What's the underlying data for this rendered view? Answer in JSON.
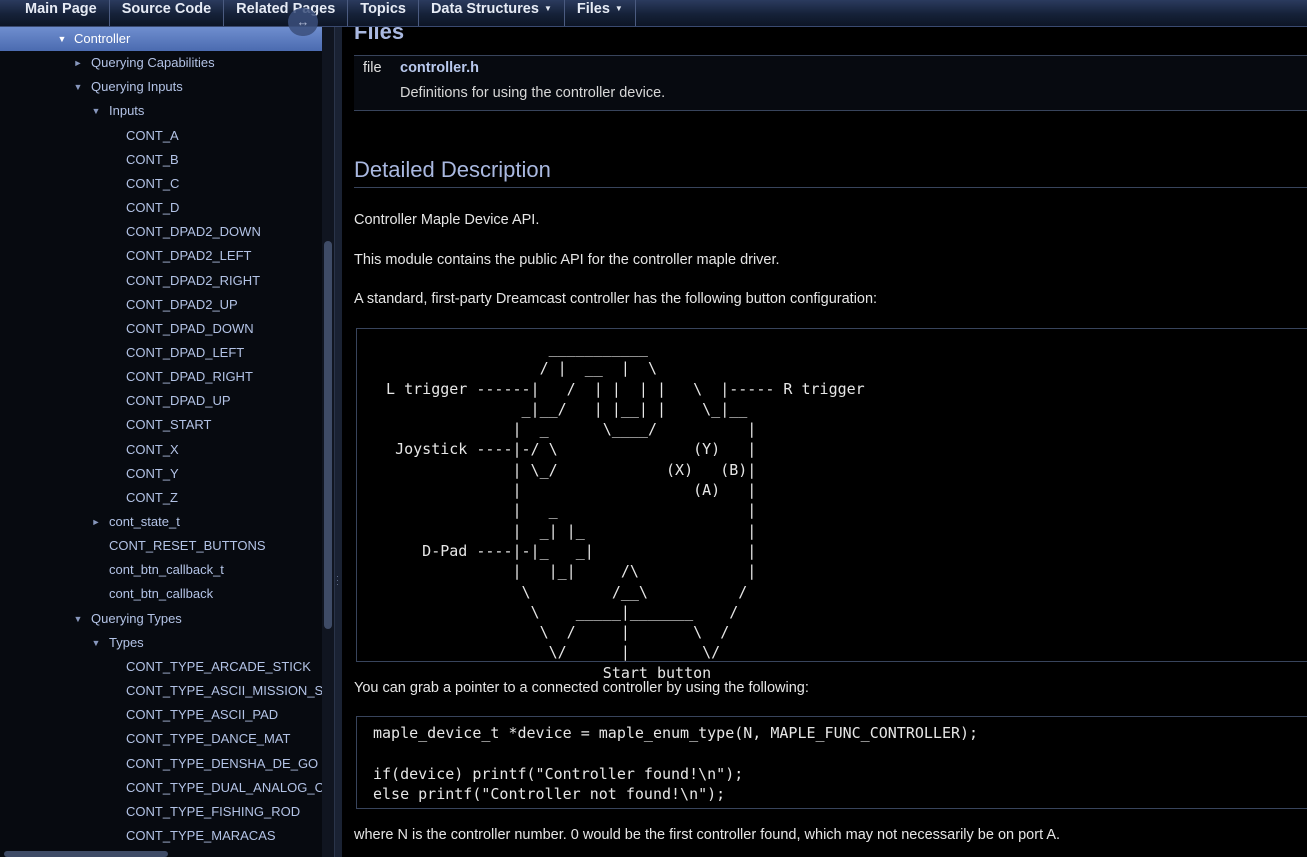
{
  "nav": {
    "items": [
      {
        "label": "Main Page",
        "dropdown": false
      },
      {
        "label": "Source Code",
        "dropdown": false
      },
      {
        "label": "Related Pages",
        "dropdown": false
      },
      {
        "label": "Topics",
        "dropdown": false
      },
      {
        "label": "Data Structures",
        "dropdown": true
      },
      {
        "label": "Files",
        "dropdown": true
      }
    ]
  },
  "sidebar": {
    "sync_icon": "sync-arrows-icon",
    "items": [
      {
        "label": "Controller",
        "level": 0,
        "arrow": "open",
        "selected": true
      },
      {
        "label": "Querying Capabilities",
        "level": 1,
        "arrow": "closed"
      },
      {
        "label": "Querying Inputs",
        "level": 1,
        "arrow": "open"
      },
      {
        "label": "Inputs",
        "level": 2,
        "arrow": "open"
      },
      {
        "label": "CONT_A",
        "level": 3,
        "arrow": "none"
      },
      {
        "label": "CONT_B",
        "level": 3,
        "arrow": "none"
      },
      {
        "label": "CONT_C",
        "level": 3,
        "arrow": "none"
      },
      {
        "label": "CONT_D",
        "level": 3,
        "arrow": "none"
      },
      {
        "label": "CONT_DPAD2_DOWN",
        "level": 3,
        "arrow": "none"
      },
      {
        "label": "CONT_DPAD2_LEFT",
        "level": 3,
        "arrow": "none"
      },
      {
        "label": "CONT_DPAD2_RIGHT",
        "level": 3,
        "arrow": "none"
      },
      {
        "label": "CONT_DPAD2_UP",
        "level": 3,
        "arrow": "none"
      },
      {
        "label": "CONT_DPAD_DOWN",
        "level": 3,
        "arrow": "none"
      },
      {
        "label": "CONT_DPAD_LEFT",
        "level": 3,
        "arrow": "none"
      },
      {
        "label": "CONT_DPAD_RIGHT",
        "level": 3,
        "arrow": "none"
      },
      {
        "label": "CONT_DPAD_UP",
        "level": 3,
        "arrow": "none"
      },
      {
        "label": "CONT_START",
        "level": 3,
        "arrow": "none"
      },
      {
        "label": "CONT_X",
        "level": 3,
        "arrow": "none"
      },
      {
        "label": "CONT_Y",
        "level": 3,
        "arrow": "none"
      },
      {
        "label": "CONT_Z",
        "level": 3,
        "arrow": "none"
      },
      {
        "label": "cont_state_t",
        "level": 2,
        "arrow": "closed"
      },
      {
        "label": "CONT_RESET_BUTTONS",
        "level": 2,
        "arrow": "none"
      },
      {
        "label": "cont_btn_callback_t",
        "level": 2,
        "arrow": "none"
      },
      {
        "label": "cont_btn_callback",
        "level": 2,
        "arrow": "none"
      },
      {
        "label": "Querying Types",
        "level": 1,
        "arrow": "open"
      },
      {
        "label": "Types",
        "level": 2,
        "arrow": "open"
      },
      {
        "label": "CONT_TYPE_ARCADE_STICK",
        "level": 3,
        "arrow": "none"
      },
      {
        "label": "CONT_TYPE_ASCII_MISSION_STICK",
        "level": 3,
        "arrow": "none"
      },
      {
        "label": "CONT_TYPE_ASCII_PAD",
        "level": 3,
        "arrow": "none"
      },
      {
        "label": "CONT_TYPE_DANCE_MAT",
        "level": 3,
        "arrow": "none"
      },
      {
        "label": "CONT_TYPE_DENSHA_DE_GO",
        "level": 3,
        "arrow": "none"
      },
      {
        "label": "CONT_TYPE_DUAL_ANALOG_C",
        "level": 3,
        "arrow": "none"
      },
      {
        "label": "CONT_TYPE_FISHING_ROD",
        "level": 3,
        "arrow": "none"
      },
      {
        "label": "CONT_TYPE_MARACAS",
        "level": 3,
        "arrow": "none"
      }
    ]
  },
  "content": {
    "files_heading": "Files",
    "file_kind": "file",
    "file_name": "controller.h",
    "file_desc": "Definitions for using the controller device.",
    "detail_heading": "Detailed Description",
    "brief": "Controller Maple Device API.",
    "intro": "This module contains the public API for the controller maple driver.",
    "config_intro": "A standard, first-party Dreamcast controller has the following button configuration:",
    "ascii_art": "                    ___________\n                   / |  __  |  \\\n  L trigger ------|   /  | |  | |   \\  |----- R trigger\n                 _|__/   | |__| |    \\_|__\n                |  _      \\____/          |\n   Joystick ----|-/ \\               (Y)   |\n                | \\_/            (X)   (B)|\n                |                   (A)   |\n                |   _                     |\n                |  _| |_                  |\n      D-Pad ----|-|_   _|                 |\n                |   |_|     /\\            |\n                 \\         /__\\          /\n                  \\    _____|_______    /\n                   \\  /     |       \\  /\n                    \\/      |        \\/\n                          Start button",
    "pointer_intro": "You can grab a pointer to a connected controller by using the following:",
    "code": "maple_device_t *device = maple_enum_type(N, MAPLE_FUNC_CONTROLLER);\n\nif(device) printf(\"Controller found!\\n\");\nelse printf(\"Controller not found!\\n\");",
    "footer_note": "where N is the controller number. 0 would be the first controller found, which may not necessarily be on port A."
  }
}
